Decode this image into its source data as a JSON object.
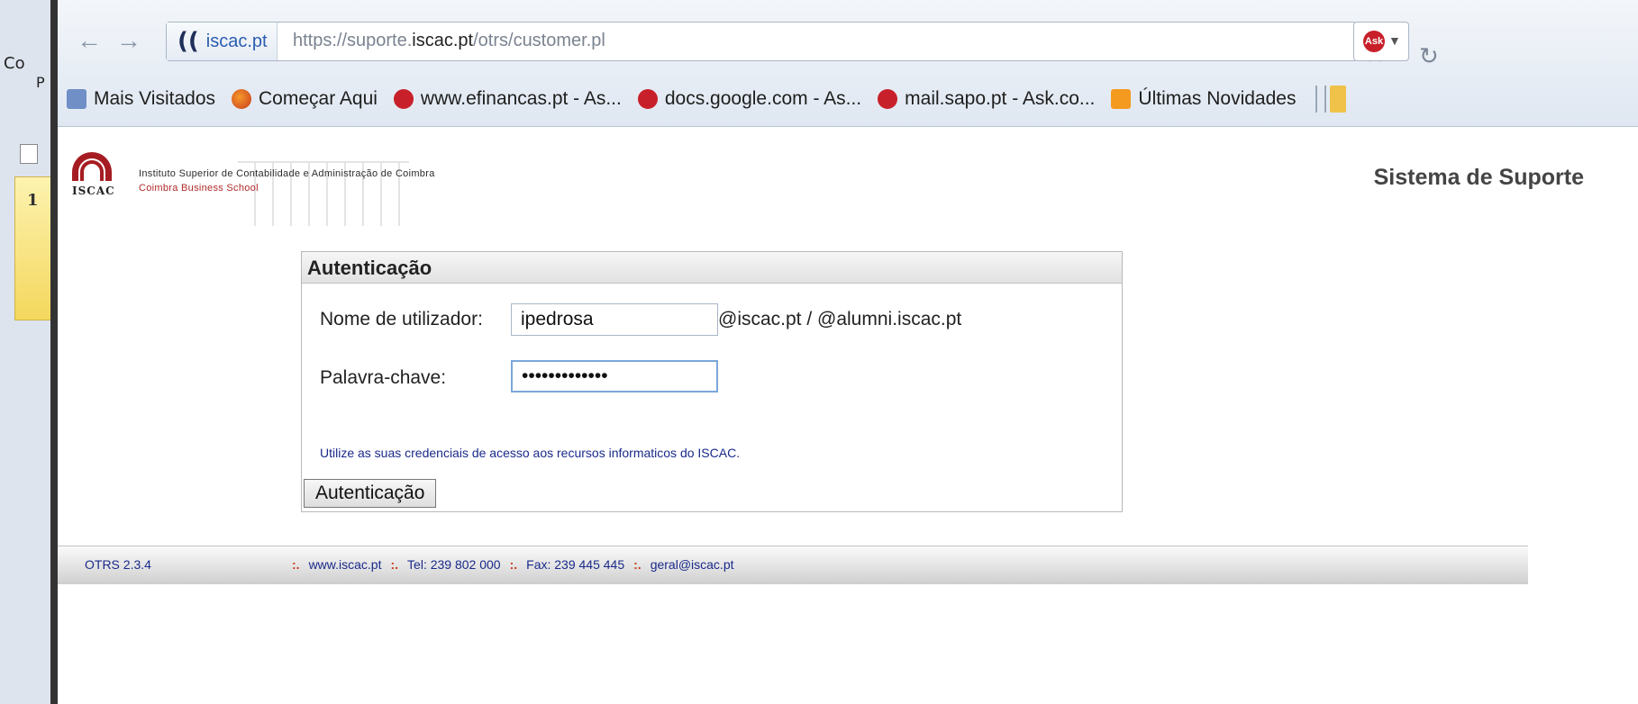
{
  "left_app": {
    "text_co": "Co",
    "text_p": "P",
    "page_number": "1"
  },
  "browser": {
    "identity": {
      "paren": "((",
      "domain": "iscac.pt"
    },
    "url": {
      "prefix": "https://suporte.",
      "host": "iscac.pt",
      "path": "/otrs/customer.pl"
    },
    "bookmarks": [
      {
        "label": "Mais Visitados",
        "icon": "most-visited-icon"
      },
      {
        "label": "Começar Aqui",
        "icon": "firefox-icon"
      },
      {
        "label": "www.efinancas.pt - As...",
        "icon": "ask-icon"
      },
      {
        "label": "docs.google.com - As...",
        "icon": "ask-icon"
      },
      {
        "label": "mail.sapo.pt - Ask.co...",
        "icon": "ask-icon"
      },
      {
        "label": "Últimas Novidades",
        "icon": "rss-icon"
      }
    ]
  },
  "header": {
    "logo_abbr": "ISCAC",
    "institution_line1": "Instituto Superior de Contabilidade e Administração de Coimbra",
    "institution_line2": "Coimbra Business School",
    "system_title": "Sistema de Suporte"
  },
  "login": {
    "title": "Autenticação",
    "username_label": "Nome de utilizador:",
    "username_value": "ipedrosa",
    "domain_hint": "@iscac.pt / @alumni.iscac.pt",
    "password_label": "Palavra-chave:",
    "password_mask": "•••••••••••••",
    "help_text": "Utilize as suas credenciais de acesso aos recursos informaticos do ISCAC.",
    "submit_label": "Autenticação"
  },
  "footer": {
    "version": "OTRS 2.3.4",
    "website": "www.iscac.pt",
    "tel": "Tel: 239 802 000",
    "fax": "Fax: 239 445 445",
    "email": "geral@iscac.pt"
  }
}
